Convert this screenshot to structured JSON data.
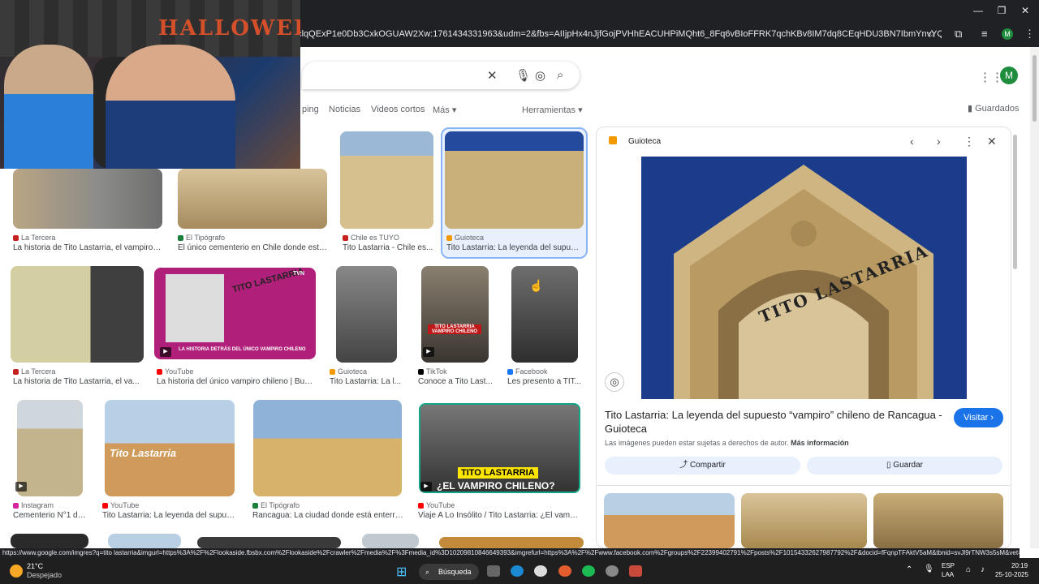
{
  "browser": {
    "url": "_clqQExP1e0Db3CxkOGUAW2Xw:1761434331963&udm=2&fbs=AIIjpHx4nJjfGojPVHhEACUHPiMQht6_8Fq6vBIoFFRK7qchKBv8IM7dq8CEqHDU3BN7IbmYnvYQ6rIhpD6d6bj_VyqCDVICi...",
    "profile_initial": "M"
  },
  "webcam": {
    "sign": "HALLOWEEN"
  },
  "search": {
    "clear_icon": "close-icon",
    "tabs": [
      "ping",
      "Noticias",
      "Videos cortos",
      "Más"
    ],
    "tools_label": "Herramientas",
    "saved_label": "Guardados",
    "avatar_initial": "M"
  },
  "results": [
    {
      "source": "La Tercera",
      "title": "La historia de Tito Lastarria, el vampiro c...",
      "src_color": "#c5221f"
    },
    {
      "source": "El Tipógrafo",
      "title": "El único cementerio en Chile donde está...",
      "src_color": "#188038"
    },
    {
      "source": "Chile es TUYO",
      "title": "Tito Lastarria - Chile es...",
      "src_color": "#c5221f"
    },
    {
      "source": "Guioteca",
      "title": "Tito Lastarria: La leyenda del supue...",
      "src_color": "#f29900"
    },
    {
      "source": "La Tercera",
      "title": "La historia de Tito Lastarria, el va...",
      "src_color": "#c5221f"
    },
    {
      "source": "YouTube",
      "title": "La historia del único vampiro chileno | Bue...",
      "src_color": "#ff0000"
    },
    {
      "source": "Guioteca",
      "title": "Tito Lastarria: La l...",
      "src_color": "#f29900"
    },
    {
      "source": "TikTok",
      "title": "Conoce a Tito Last...",
      "src_color": "#000000"
    },
    {
      "source": "Facebook",
      "title": "Les presento a TIT...",
      "src_color": "#1877f2"
    },
    {
      "source": "Instagram",
      "title": "Cementerio N°1 de...",
      "src_color": "#d6249f"
    },
    {
      "source": "YouTube",
      "title": "Tito Lastarria: La leyenda del supue...",
      "src_color": "#ff0000"
    },
    {
      "source": "El Tipógrafo",
      "title": "Rancagua: La ciudad donde está enterra...",
      "src_color": "#188038"
    },
    {
      "source": "YouTube",
      "title": "Viaje A Lo Insólito / Tito Lastarria: ¿El vampir...",
      "src_color": "#ff0000"
    }
  ],
  "thumb_text": {
    "tvn_title": "TITO LASTARRIA",
    "tvn_caption": "LA HISTORIA DETRÁS DEL ÚNICO VAMPIRO CHILENO",
    "tvn_logo": "TVN",
    "tiktok_caption": "TITO LASTARRIA VAMPIRO CHILENO",
    "yt1_caption": "Tito Lastarria",
    "yt2_line1": "TITO LASTARRIA",
    "yt2_line2": "¿EL VAMPIRO CHILENO?"
  },
  "panel": {
    "source": "Guioteca",
    "image_text": "TITO LASTARRIA",
    "title": "Tito Lastarria: La leyenda del supuesto “vampiro” chileno de Rancagua - Guioteca",
    "copyright": "Las imágenes pueden estar sujetas a derechos de autor.",
    "more_info": "Más información",
    "visit_label": "Visitar",
    "share_label": "Compartir",
    "save_label": "Guardar"
  },
  "status_url": "https://www.google.com/imgres?q=tito lastarria&imgurl=https%3A%2F%2Flookaside.fbsbx.com%2Flookaside%2Fcrawler%2Fmedia%2F%3Fmedia_id%3D10209810846649393&imgrefurl=https%3A%2F%2Fwww.facebook.com%2Fgroups%2F22399402791%2Fposts%2F10154332627987792%2F&docid=fFqnpTFAktV5aM&tbnid=svJl9rTNW3s5sM&vet=12...",
  "taskbar": {
    "temp": "21°C",
    "weather": "Despejado",
    "search": "Búsqueda",
    "lang1": "ESP",
    "lang2": "LAA",
    "time": "20:19",
    "date": "25-10-2025"
  }
}
